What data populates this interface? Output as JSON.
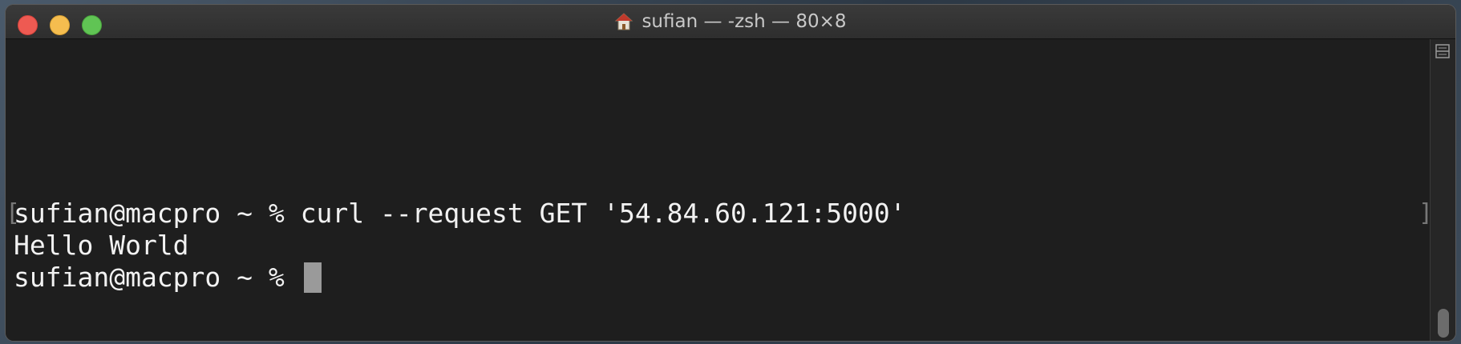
{
  "window": {
    "title": "sufian — -zsh — 80×8",
    "title_icon": "home-icon"
  },
  "terminal": {
    "lines": [
      "sufian@macpro ~ % curl --request GET '54.84.60.121:5000'",
      "Hello World",
      "sufian@macpro ~ % "
    ],
    "bracket_left": "[",
    "bracket_right": "]"
  },
  "colors": {
    "close": "#ee5a52",
    "minimize": "#f5bd4f",
    "maximize": "#60c454",
    "terminal_bg": "#1e1e1e",
    "text": "#f2f2f2",
    "cursor": "#9a9a9a"
  }
}
